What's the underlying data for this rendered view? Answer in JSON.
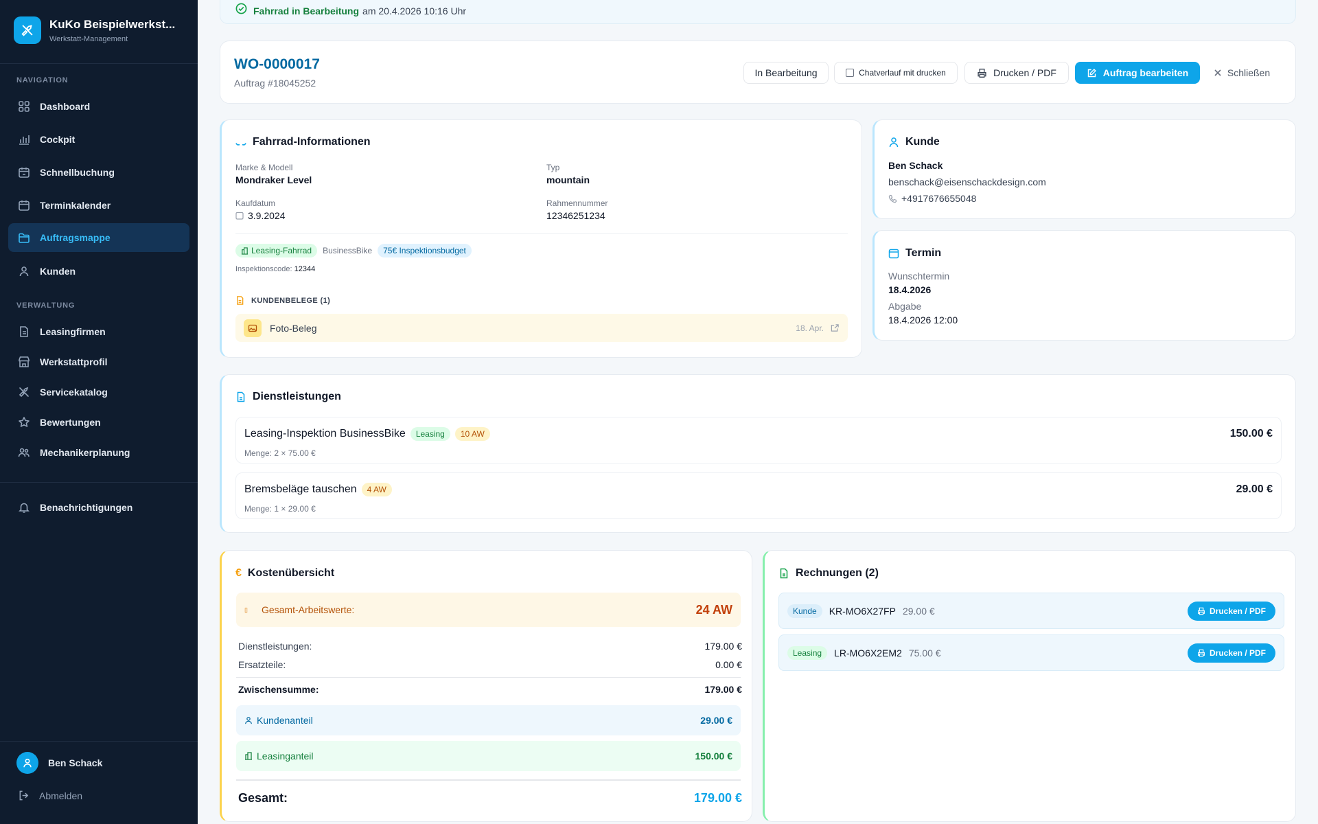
{
  "app": {
    "title": "KuKo Beispielwerkst...",
    "subtitle": "Werkstatt-Management"
  },
  "colors": {
    "accent": "#0ea5e9",
    "sidebar_bg": "#0f1c2e",
    "active_bg": "#143456",
    "success": "#16a34a",
    "warning": "#d97706"
  },
  "sidebar": {
    "nav_heading": "NAVIGATION",
    "nav_items": [
      {
        "label": "Dashboard",
        "icon": "grid-icon"
      },
      {
        "label": "Cockpit",
        "icon": "bar-chart-icon"
      },
      {
        "label": "Schnellbuchung",
        "icon": "calendar-plus-icon"
      },
      {
        "label": "Terminkalender",
        "icon": "calendar-icon"
      },
      {
        "label": "Auftragsmappe",
        "icon": "folder-icon",
        "active": true
      },
      {
        "label": "Kunden",
        "icon": "users-icon"
      }
    ],
    "admin_heading": "VERWALTUNG",
    "admin_items": [
      {
        "label": "Leasingfirmen",
        "icon": "file-icon"
      },
      {
        "label": "Werkstattprofil",
        "icon": "store-icon"
      },
      {
        "label": "Servicekatalog",
        "icon": "wrench-icon"
      },
      {
        "label": "Bewertungen",
        "icon": "star-icon"
      },
      {
        "label": "Mechanikerplanung",
        "icon": "team-icon"
      }
    ],
    "notifications": "Benachrichtigungen",
    "user_name": "Ben Schack",
    "logout": "Abmelden"
  },
  "status_banner": {
    "bold": "Fahrrad in Bearbeitung",
    "rest": "am 20.4.2026 10:16 Uhr"
  },
  "order": {
    "number": "WO-0000017",
    "sub": "Auftrag #18045252",
    "status": "In Bearbeitung",
    "print_chat": "Chatverlauf mit drucken",
    "print": "Drucken / PDF",
    "edit": "Auftrag bearbeiten",
    "close": "Schließen"
  },
  "bike": {
    "title": "Fahrrad-Informationen",
    "brand_label": "Marke & Modell",
    "brand": "Mondraker Level",
    "type_label": "Typ",
    "type": "mountain",
    "purchase_label": "Kaufdatum",
    "purchase": "3.9.2024",
    "frame_label": "Rahmennummer",
    "frame": "12346251234",
    "leasing_badge": "Leasing-Fahrrad",
    "leasing_company": "BusinessBike",
    "budget_badge": "75€ Inspektionsbudget",
    "inspection_label": "Inspektionscode:",
    "inspection_code": "12344",
    "docs_title": "KUNDENBELEGE (1)",
    "doc_name": "Foto-Beleg",
    "doc_date": "18. Apr."
  },
  "customer": {
    "title": "Kunde",
    "name": "Ben Schack",
    "email": "benschack@eisenschackdesign.com",
    "phone": "+4917676655048"
  },
  "appointment": {
    "title": "Termin",
    "wish_label": "Wunschtermin",
    "wish": "18.4.2026",
    "drop_label": "Abgabe",
    "drop": "18.4.2026 12:00"
  },
  "services": {
    "title": "Dienstleistungen",
    "items": [
      {
        "name": "Leasing-Inspektion BusinessBike",
        "badge1": "Leasing",
        "badge2": "10 AW",
        "qty": "Menge: 2 × 75.00 €",
        "price": "150.00 €"
      },
      {
        "name": "Bremsbeläge tauschen",
        "badge1": "",
        "badge2": "4 AW",
        "qty": "Menge: 1 × 29.00 €",
        "price": "29.00 €"
      }
    ]
  },
  "costs": {
    "title": "Kostenübersicht",
    "aw_label": "Gesamt-Arbeitswerte:",
    "aw_value": "24 AW",
    "services_label": "Dienstleistungen:",
    "services_value": "179.00 €",
    "parts_label": "Ersatzteile:",
    "parts_value": "0.00 €",
    "subtotal_label": "Zwischensumme:",
    "subtotal_value": "179.00 €",
    "customer_label": "Kundenanteil",
    "customer_value": "29.00 €",
    "leasing_label": "Leasinganteil",
    "leasing_value": "150.00 €",
    "total_label": "Gesamt:",
    "total_value": "179.00 €"
  },
  "invoices": {
    "title": "Rechnungen (2)",
    "items": [
      {
        "tag": "Kunde",
        "number": "KR-MO6X27FP",
        "amount": "29.00 €",
        "button": "Drucken / PDF"
      },
      {
        "tag": "Leasing",
        "number": "LR-MO6X2EM2",
        "amount": "75.00 €",
        "button": "Drucken / PDF"
      }
    ]
  }
}
